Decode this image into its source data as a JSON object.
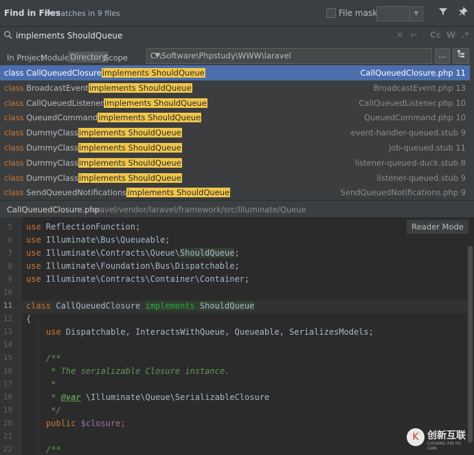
{
  "header": {
    "title": "Find in Files",
    "matches": "9 matches in 9 files",
    "file_mask_label": "File mask:",
    "file_mask_value": ""
  },
  "search": {
    "query": "implements ShouldQueue",
    "opt_case": "Cc",
    "opt_words": "W",
    "opt_regex": ".*"
  },
  "scope": {
    "in_project": "In Project",
    "module": "Module",
    "directory": "Directory",
    "scope": "Scope",
    "path": "C:\\Software\\Phpstudy\\WWW\\laravel",
    "dots": "..."
  },
  "results": [
    {
      "keyword": "class",
      "name": "CallQueuedClosure",
      "match": "implements ShouldQueue",
      "file": "CallQueuedClosure.php 11",
      "selected": true
    },
    {
      "keyword": "class",
      "name": "BroadcastEvent",
      "match": "implements ShouldQueue",
      "file": "BroadcastEvent.php 13"
    },
    {
      "keyword": "class",
      "name": "CallQueuedListener",
      "match": "implements ShouldQueue",
      "file": "CallQueuedListener.php 10"
    },
    {
      "keyword": "class",
      "name": "QueuedCommand",
      "match": "implements ShouldQueue",
      "file": "QueuedCommand.php 10"
    },
    {
      "keyword": "class",
      "name": "DummyClass",
      "match": "implements ShouldQueue",
      "file": "event-handler-queued.stub 9"
    },
    {
      "keyword": "class",
      "name": "DummyClass",
      "match": "implements ShouldQueue",
      "file": "job-queued.stub 11"
    },
    {
      "keyword": "class",
      "name": "DummyClass",
      "match": "implements ShouldQueue",
      "file": "listener-queued-duck.stub 8"
    },
    {
      "keyword": "class",
      "name": "DummyClass",
      "match": "implements ShouldQueue",
      "file": "listener-queued.stub 9"
    },
    {
      "keyword": "class",
      "name": "SendQueuedNotifications",
      "match": "implements ShouldQueue",
      "file": "SendQueuedNotifications.php 9"
    }
  ],
  "preview": {
    "file": "CallQueuedClosure.php",
    "path": "laravel/vendor/laravel/framework/src/Illuminate/Queue",
    "reader_mode": "Reader Mode"
  },
  "editor": {
    "line_numbers": [
      "5",
      "6",
      "7",
      "8",
      "9",
      "10",
      "11",
      "12",
      "13",
      "14",
      "15",
      "16",
      "17",
      "18",
      "19",
      "20",
      "21",
      "22"
    ],
    "current_line": "11",
    "use_kw": "use",
    "l5": "ReflectionFunction;",
    "l6": "Illuminate\\Bus\\Queueable;",
    "l7a": "Illuminate\\Contracts\\Queue\\",
    "l7b": "ShouldQueue",
    "l7c": ";",
    "l8": "Illuminate\\Foundation\\Bus\\Dispatchable;",
    "l9": "Illuminate\\Contracts\\Container\\Container;",
    "l11_class": "class",
    "l11_name": "CallQueuedClosure",
    "l11_impl": "implements",
    "l11_iface": "ShouldQueue",
    "l12": "{",
    "l13": "Dispatchable, InteractsWithQueue, Queueable, SerializesModels;",
    "l15": "/**",
    "l16": "* The serializable Closure instance.",
    "l17": "*",
    "l18_star": "*",
    "l18_tag": "@var",
    "l18_type": "\\Illuminate\\Queue\\SerializableClosure",
    "l19": "*/",
    "l20_kw": "public",
    "l20_var": "$closure",
    "l20_end": ";",
    "l22": "/**"
  },
  "watermark": {
    "symbol": "K",
    "text": "创新互联",
    "sub": "CHUANG XIN HU LIAN"
  },
  "colors": {
    "selection": "#4b6eaf",
    "match_highlight": "#f0c64b",
    "keyword": "#cc7832",
    "comment": "#629755",
    "background": "#2b2b2b"
  }
}
